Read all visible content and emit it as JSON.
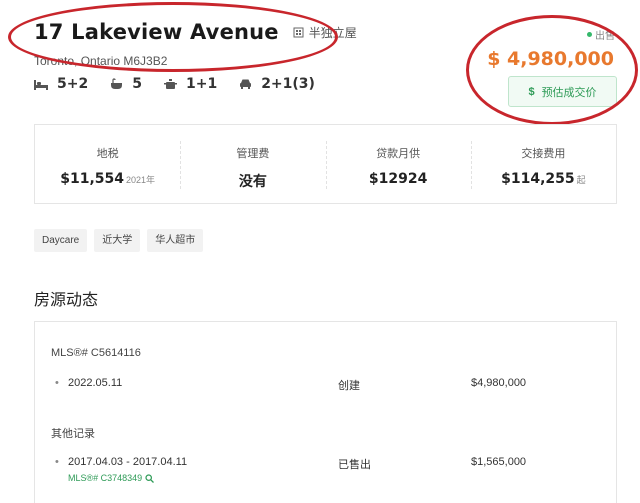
{
  "listing": {
    "title": "17 Lakeview Avenue",
    "property_type": "半独立屋",
    "address": "Toronto, Ontario M6J3B2",
    "status": "出售",
    "price": "$ 4,980,000",
    "estimate_button": {
      "icon": "$",
      "label": "预估成交价"
    }
  },
  "features": {
    "bedrooms": "5+2",
    "bathrooms": "5",
    "kitchens": "1+1",
    "parking": "2+1(3)"
  },
  "stats": [
    {
      "label": "地税",
      "value": "$11,554",
      "suffix": "2021年"
    },
    {
      "label": "管理费",
      "value": "没有",
      "suffix": ""
    },
    {
      "label": "贷款月供",
      "value": "$12924",
      "suffix": ""
    },
    {
      "label": "交接费用",
      "value": "$114,255",
      "suffix": "起"
    }
  ],
  "tags": [
    "Daycare",
    "近大学",
    "华人超市"
  ],
  "activity": {
    "section_title": "房源动态",
    "mls": "MLS®# C5614116",
    "current": {
      "date": "2022.05.11",
      "event": "创建",
      "amount": "$4,980,000"
    },
    "other_title": "其他记录",
    "history": [
      {
        "date": "2017.04.03 - 2017.04.11",
        "event": "已售出",
        "amount": "$1,565,000",
        "mls": "MLS®# C3748349"
      }
    ]
  },
  "colors": {
    "price": "#e8792e",
    "accent_green": "#2e9b57",
    "annotation_red": "#c8262c"
  }
}
